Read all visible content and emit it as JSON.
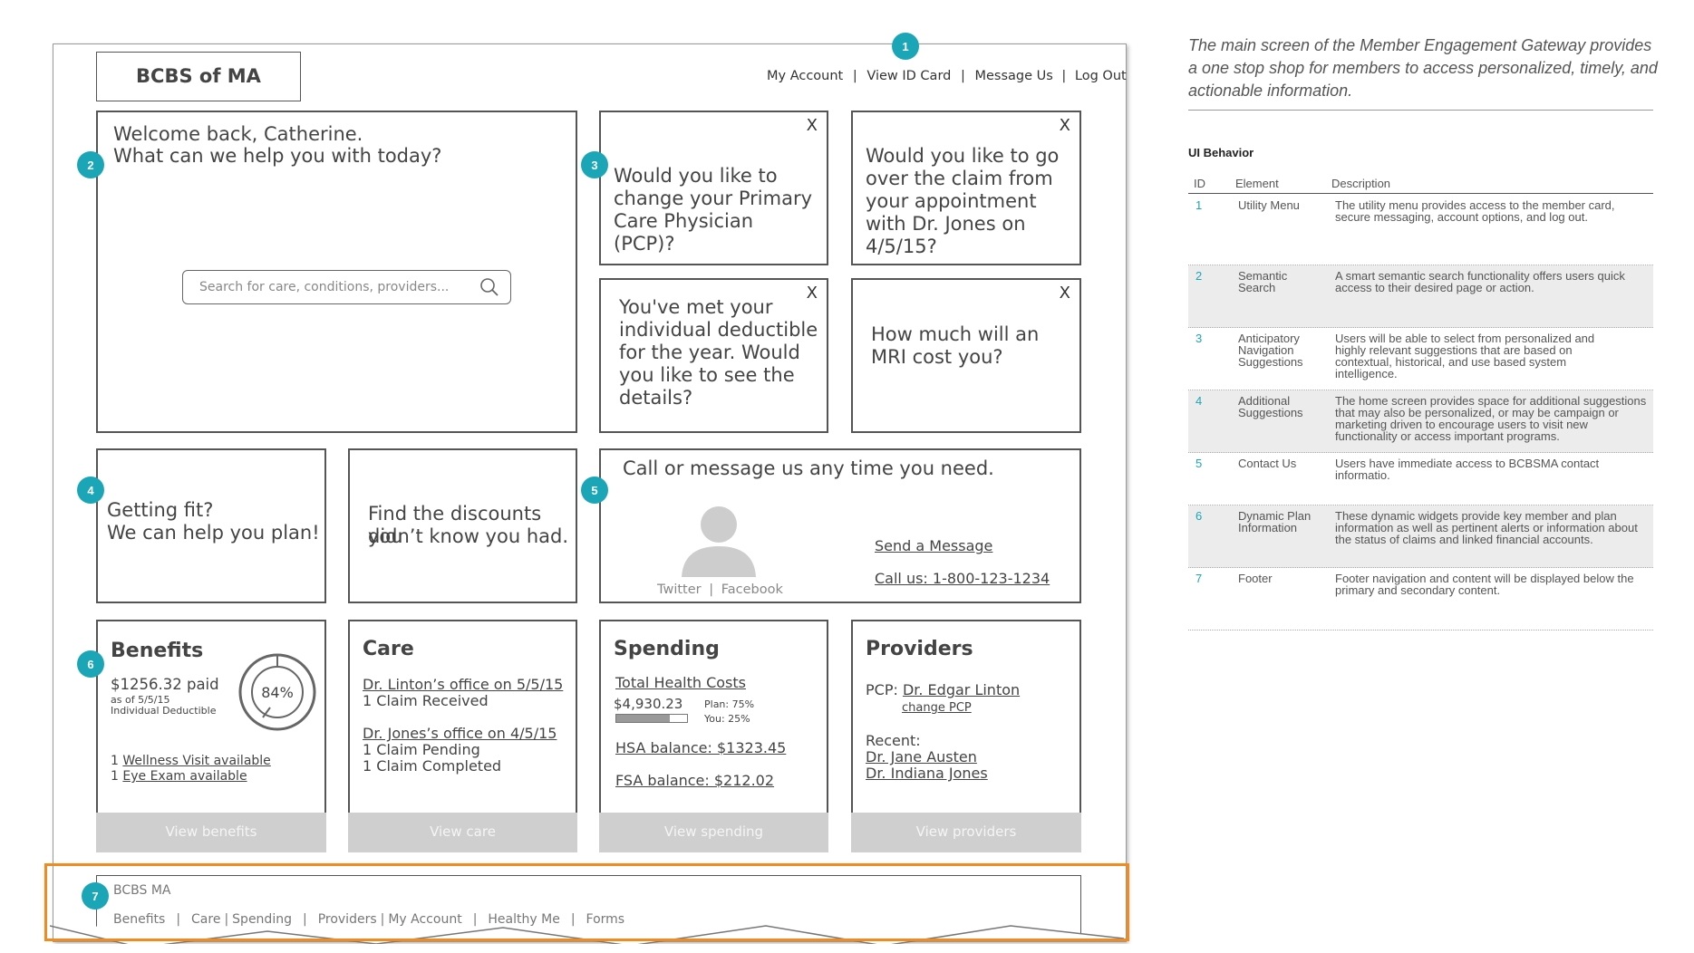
{
  "header": {
    "logo": "BCBS of MA",
    "utility_menu": [
      "My Account",
      "View ID Card",
      "Message Us",
      "Log Out"
    ],
    "separator": "|"
  },
  "welcome": {
    "line1": "Welcome back, Catherine.",
    "line2": "What can we help you with today?",
    "search_placeholder": "Search for care, conditions, providers..."
  },
  "suggestions": [
    {
      "text": "Would you like to change your Primary Care Physician (PCP)?",
      "close": "X"
    },
    {
      "text": "Would you like to go over the claim from your appointment with Dr. Jones on 4/5/15?",
      "close": "X"
    },
    {
      "text": "You've met your individual deductible for the year. Would you like to see the details?",
      "close": "X"
    },
    {
      "text": "How much will an MRI cost you?",
      "close": "X"
    }
  ],
  "additional": [
    {
      "line1": "Getting fit?",
      "line2": "We can help you plan!"
    },
    {
      "line1": "Find the discounts you",
      "line2": "didn’t know you had."
    }
  ],
  "contact": {
    "title": "Call or message us any time you need.",
    "send": "Send a Message",
    "call": "Call us: 1-800-123-1234",
    "twitter": "Twitter",
    "facebook": "Facebook"
  },
  "benefits": {
    "title": "Benefits",
    "paid": "$1256.32 paid",
    "as_of": "as of 5/5/15",
    "deductible": "Individual Deductible",
    "percent": "84%",
    "percent_value": 84,
    "wellness_prefix": "1",
    "wellness": "Wellness Visit available",
    "eye_prefix": "1",
    "eye": "Eye Exam available",
    "button": "View benefits"
  },
  "care": {
    "title": "Care",
    "visit1": "Dr. Linton’s office on 5/5/15",
    "visit1_claims": "1 Claim Received",
    "visit2": "Dr. Jones’s office on 4/5/15",
    "visit2_pending": "1 Claim Pending",
    "visit2_completed": "1 Claim Completed",
    "button": "View care"
  },
  "spending": {
    "title": "Spending",
    "total_label": "Total Health Costs",
    "total": "$4,930.23",
    "plan": "Plan: 75%",
    "you": "You: 25%",
    "plan_fraction": 0.75,
    "hsa": "HSA balance:  $1323.45",
    "fsa": "FSA balance:   $212.02",
    "button": "View spending"
  },
  "providers": {
    "title": "Providers",
    "pcp_label": "PCP:",
    "pcp": "Dr. Edgar Linton",
    "change": "change PCP",
    "recent_label": "Recent:",
    "recent": [
      "Dr. Jane Austen",
      "Dr. Indiana Jones"
    ],
    "button": "View providers"
  },
  "footer": {
    "brand": "BCBS MA",
    "links": [
      "Benefits",
      "Care",
      "Spending",
      "Providers",
      "My Account",
      "Healthy Me",
      "Forms"
    ]
  },
  "badges": [
    "1",
    "2",
    "3",
    "4",
    "5",
    "6",
    "7"
  ],
  "side": {
    "intro": "The main screen of the Member Engagement Gateway provides a one stop shop for members to access personalized, timely, and actionable information.",
    "heading": "UI Behavior",
    "columns": [
      "ID",
      "Element",
      "Description"
    ],
    "rows": [
      {
        "id": "1",
        "element": "Utility Menu",
        "description": "The utility menu provides access to the member card, secure messaging, account options, and log out."
      },
      {
        "id": "2",
        "element": "Semantic Search",
        "description": "A smart semantic search functionality offers users quick access to their desired page or action."
      },
      {
        "id": "3",
        "element": "Anticipatory Navigation Suggestions",
        "description": "Users will be able to select from personalized and highly relevant suggestions that are based on contextual, historical, and use based system intelligence."
      },
      {
        "id": "4",
        "element": "Additional Suggestions",
        "description": "The home screen provides space for additional suggestions that may also be personalized, or may be campaign or marketing driven to encourage users to visit new functionality or access important programs."
      },
      {
        "id": "5",
        "element": "Contact Us",
        "description": "Users have immediate access to BCBSMA contact informatio."
      },
      {
        "id": "6",
        "element": "Dynamic Plan Information",
        "description": "These dynamic widgets provide key member and plan information as well as pertinent alerts or information about the status of claims and linked financial accounts."
      },
      {
        "id": "7",
        "element": "Footer",
        "description": "Footer navigation and content will be displayed below the primary and secondary content."
      }
    ]
  },
  "colors": {
    "accent": "#1aa6b7",
    "highlight": "#f28a1e",
    "button_gray": "#cfcfcf"
  }
}
